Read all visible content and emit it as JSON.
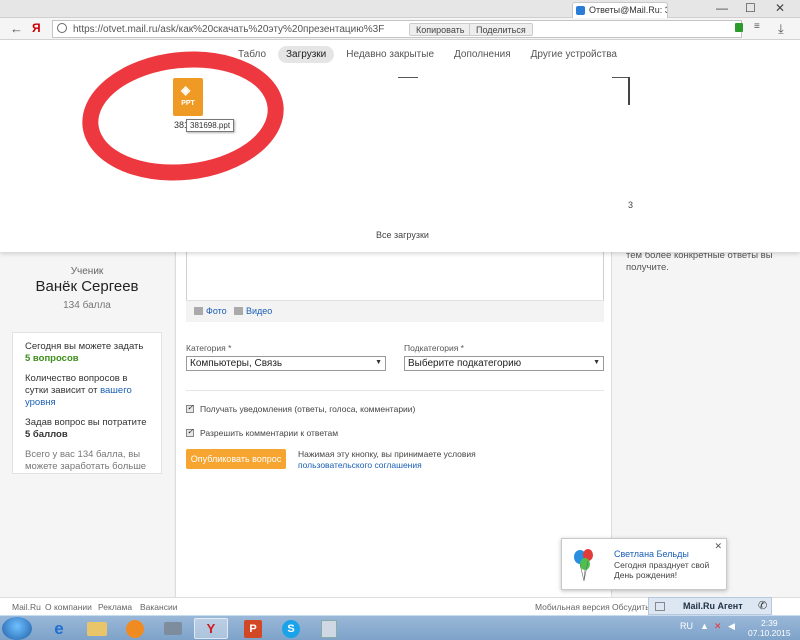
{
  "browser": {
    "tab_title": "Ответы@Mail.Ru: З",
    "url": "https://otvet.mail.ru/ask/как%20скачать%20эту%20презентацию%3F",
    "url_actions": [
      "Копировать",
      "Поделиться"
    ],
    "window_controls": [
      "—",
      "☐",
      "✕"
    ]
  },
  "downloads_panel": {
    "tabs": [
      "Табло",
      "Загрузки",
      "Недавно закрытые",
      "Дополнения",
      "Другие устройства"
    ],
    "active_tab": "Загрузки",
    "file": {
      "icon_label": "PPT",
      "name_truncated": "381",
      "tooltip_name": "381698.ppt"
    },
    "count_text": "3",
    "all_downloads_label": "Все загрузки"
  },
  "profile": {
    "rank": "Ученик",
    "name": "Ванёк Сергеев",
    "points": "134 балла",
    "info": {
      "today_line": "Сегодня вы можете задать",
      "today_count": "5 вопросов",
      "limit_line": "Количество вопросов в сутки зависит от",
      "limit_link": "вашего уровня",
      "cost_line": "Задав вопрос вы потратите",
      "cost_value": "5 баллов",
      "earn_line": "Всего у вас 134 балла, вы можете заработать больше"
    }
  },
  "form": {
    "attach_photo": "Фото",
    "attach_video": "Видео",
    "category_label": "Категория *",
    "category_value": "Компьютеры, Связь",
    "subcategory_label": "Подкатегория *",
    "subcategory_value": "Выберите подкатегорию",
    "check_notifications": "Получать уведомления (ответы, голоса, комментарии)",
    "check_comments": "Разрешить комментарии к ответам",
    "publish_button": "Опубликовать вопрос",
    "terms_text": "Нажимая эту кнопку, вы принимаете условия",
    "terms_link": "пользовательского соглашения"
  },
  "right_hint": "тем более конкретные ответы вы получите.",
  "footer": {
    "links": [
      "Mail.Ru",
      "О компании",
      "Реклама",
      "Вакансии"
    ],
    "mobile": "Мобильная версия",
    "feedback": "Обсудить",
    "agent": "Mail.Ru Агент"
  },
  "notification": {
    "name": "Светлана Бельды",
    "message_line1": "Сегодня празднует свой",
    "message_line2": "День рождения!"
  },
  "taskbar": {
    "lang": "RU",
    "time": "2:39",
    "date": "07.10.2015"
  },
  "colors": {
    "annotation_red": "#ec1c24",
    "publish_orange": "#f7a531",
    "link_blue": "#1a5fb4",
    "green": "#3a8f1c"
  }
}
